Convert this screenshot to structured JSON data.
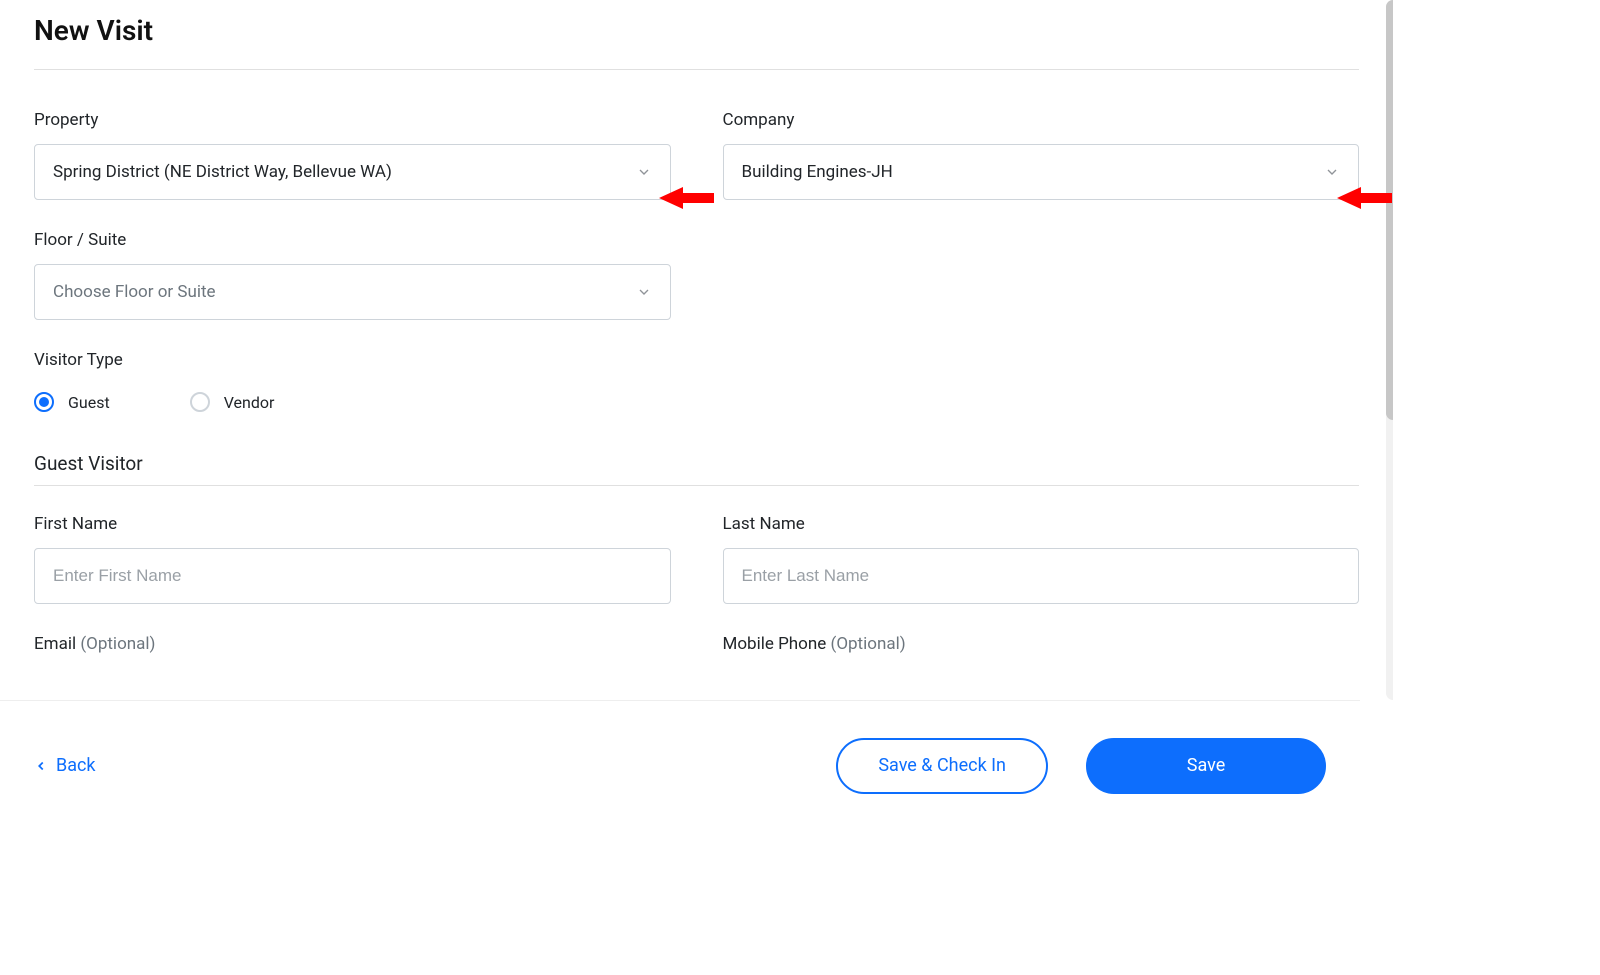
{
  "header": {
    "title": "New Visit"
  },
  "fields": {
    "property": {
      "label": "Property",
      "value": "Spring District (NE District Way, Bellevue WA)"
    },
    "company": {
      "label": "Company",
      "value": "Building Engines-JH"
    },
    "floor_suite": {
      "label": "Floor / Suite",
      "placeholder": "Choose Floor or Suite"
    },
    "visitor_type": {
      "label": "Visitor Type",
      "options": {
        "guest": "Guest",
        "vendor": "Vendor"
      },
      "selected": "guest"
    },
    "guest_section": {
      "heading": "Guest Visitor"
    },
    "first_name": {
      "label": "First Name",
      "placeholder": "Enter First Name"
    },
    "last_name": {
      "label": "Last Name",
      "placeholder": "Enter Last Name"
    },
    "email": {
      "label": "Email ",
      "optional": "(Optional)"
    },
    "mobile_phone": {
      "label": "Mobile Phone ",
      "optional": "(Optional)"
    }
  },
  "footer": {
    "back": "Back",
    "save_check_in": "Save & Check In",
    "save": "Save"
  },
  "accent_color": "#0d6efd"
}
